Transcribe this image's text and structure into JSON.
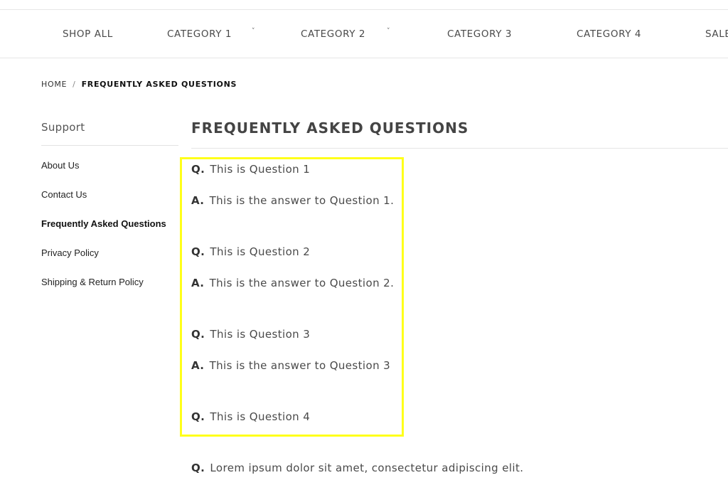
{
  "nav": {
    "items": [
      {
        "label": "SHOP ALL",
        "has_dropdown": false
      },
      {
        "label": "CATEGORY 1",
        "has_dropdown": true
      },
      {
        "label": "CATEGORY 2",
        "has_dropdown": true
      },
      {
        "label": "CATEGORY 3",
        "has_dropdown": false
      },
      {
        "label": "CATEGORY 4",
        "has_dropdown": false
      },
      {
        "label": "SALE",
        "has_dropdown": false
      }
    ],
    "chevron_glyph": "˅"
  },
  "breadcrumb": {
    "home": "HOME",
    "separator": "/",
    "current": "FREQUENTLY ASKED QUESTIONS"
  },
  "sidebar": {
    "title": "Support",
    "links": [
      {
        "label": "About Us",
        "active": false
      },
      {
        "label": "Contact Us",
        "active": false
      },
      {
        "label": "Frequently Asked Questions",
        "active": true
      },
      {
        "label": "Privacy Policy",
        "active": false
      },
      {
        "label": "Shipping & Return Policy",
        "active": false
      }
    ]
  },
  "main": {
    "title": "FREQUENTLY ASKED QUESTIONS",
    "highlight_color": "#ffff1a",
    "entries": [
      {
        "prefix": "Q.",
        "text": "This is Question 1"
      },
      {
        "prefix": "A.",
        "text": "This is the answer to Question 1."
      },
      {
        "prefix": "Q.",
        "text": "This is Question 2"
      },
      {
        "prefix": "A.",
        "text": "This is the answer to Question 2."
      },
      {
        "prefix": "Q.",
        "text": "This is Question 3"
      },
      {
        "prefix": "A.",
        "text": "This is the answer to Question 3"
      },
      {
        "prefix": "Q.",
        "text": "This is Question 4"
      },
      {
        "prefix": "Q.",
        "text": "Lorem ipsum dolor sit amet, consectetur adipiscing elit."
      }
    ]
  }
}
